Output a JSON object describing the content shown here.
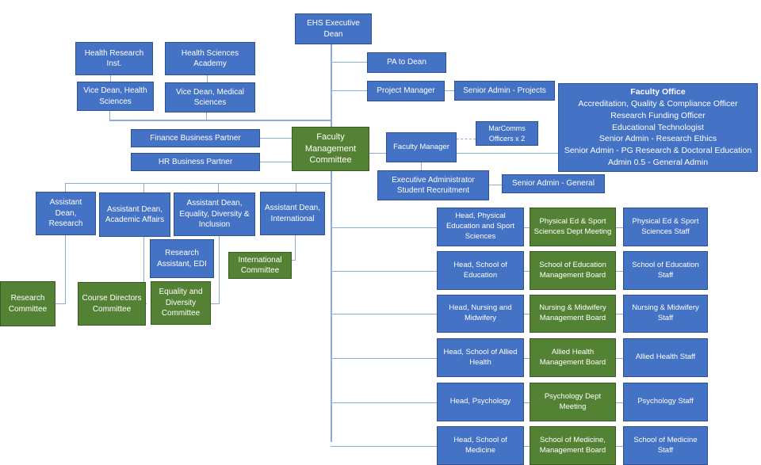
{
  "colors": {
    "box": "#4472C4",
    "committee": "#548235",
    "line": "#8FAADC"
  },
  "dean": "EHS Executive Dean",
  "hri": "Health Research Inst.",
  "hsa": "Health Sciences Academy",
  "vd_hs": "Vice Dean, Health Sciences",
  "vd_ms": "Vice Dean, Medical Sciences",
  "pa": "PA to Dean",
  "pm": "Project Manager",
  "sa_projects": "Senior Admin - Projects",
  "faculty_office": {
    "title": "Faculty Office",
    "items": [
      "Accreditation, Quality & Compliance Officer",
      "Research Funding Officer",
      "Educational Technologist",
      "Senior Admin - Research Ethics",
      "Senior Admin -  PG Research & Doctoral Education",
      "Admin 0.5 - General Admin"
    ]
  },
  "finance": "Finance Business Partner",
  "hr": "HR Business Partner",
  "fmc": "Faculty Management Committee",
  "fm": "Faculty Manager",
  "marcomms": "MarComms Officers x 2",
  "exec_admin": "Executive Administrator Student Recruitment",
  "sa_general": "Senior Admin - General",
  "ad_research": "Assistant Dean, Research",
  "ad_academic": "Assistant Dean, Academic Affairs",
  "ad_edi": "Assistant Dean, Equality, Diversity & Inclusion",
  "ad_intl": "Assistant Dean, International",
  "ra_edi": "Research Assistant, EDI",
  "intl_committee": "International Committee",
  "research_committee": "Research Committee",
  "course_committee": "Course Directors Committee",
  "ed_committee": "Equality and Diversity Committee",
  "schools": [
    {
      "head": "Head, Physical Education and Sport Sciences",
      "board": "Physical Ed & Sport Sciences Dept Meeting",
      "staff": "Physical Ed & Sport Sciences Staff"
    },
    {
      "head": "Head, School of Education",
      "board": "School of Education Management Board",
      "staff": "School of Education Staff"
    },
    {
      "head": "Head, Nursing and Midwifery",
      "board": "Nursing & Midwifery Management Board",
      "staff": "Nursing & Midwifery Staff"
    },
    {
      "head": "Head, School of Allied Health",
      "board": "Allied Health Management Board",
      "staff": "Allied Health Staff"
    },
    {
      "head": "Head, Psychology",
      "board": "Psychology Dept Meeting",
      "staff": "Psychology Staff"
    },
    {
      "head": "Head, School of Medicine",
      "board": "School of Medicine, Management Board",
      "staff": "School of Medicine Staff"
    }
  ]
}
